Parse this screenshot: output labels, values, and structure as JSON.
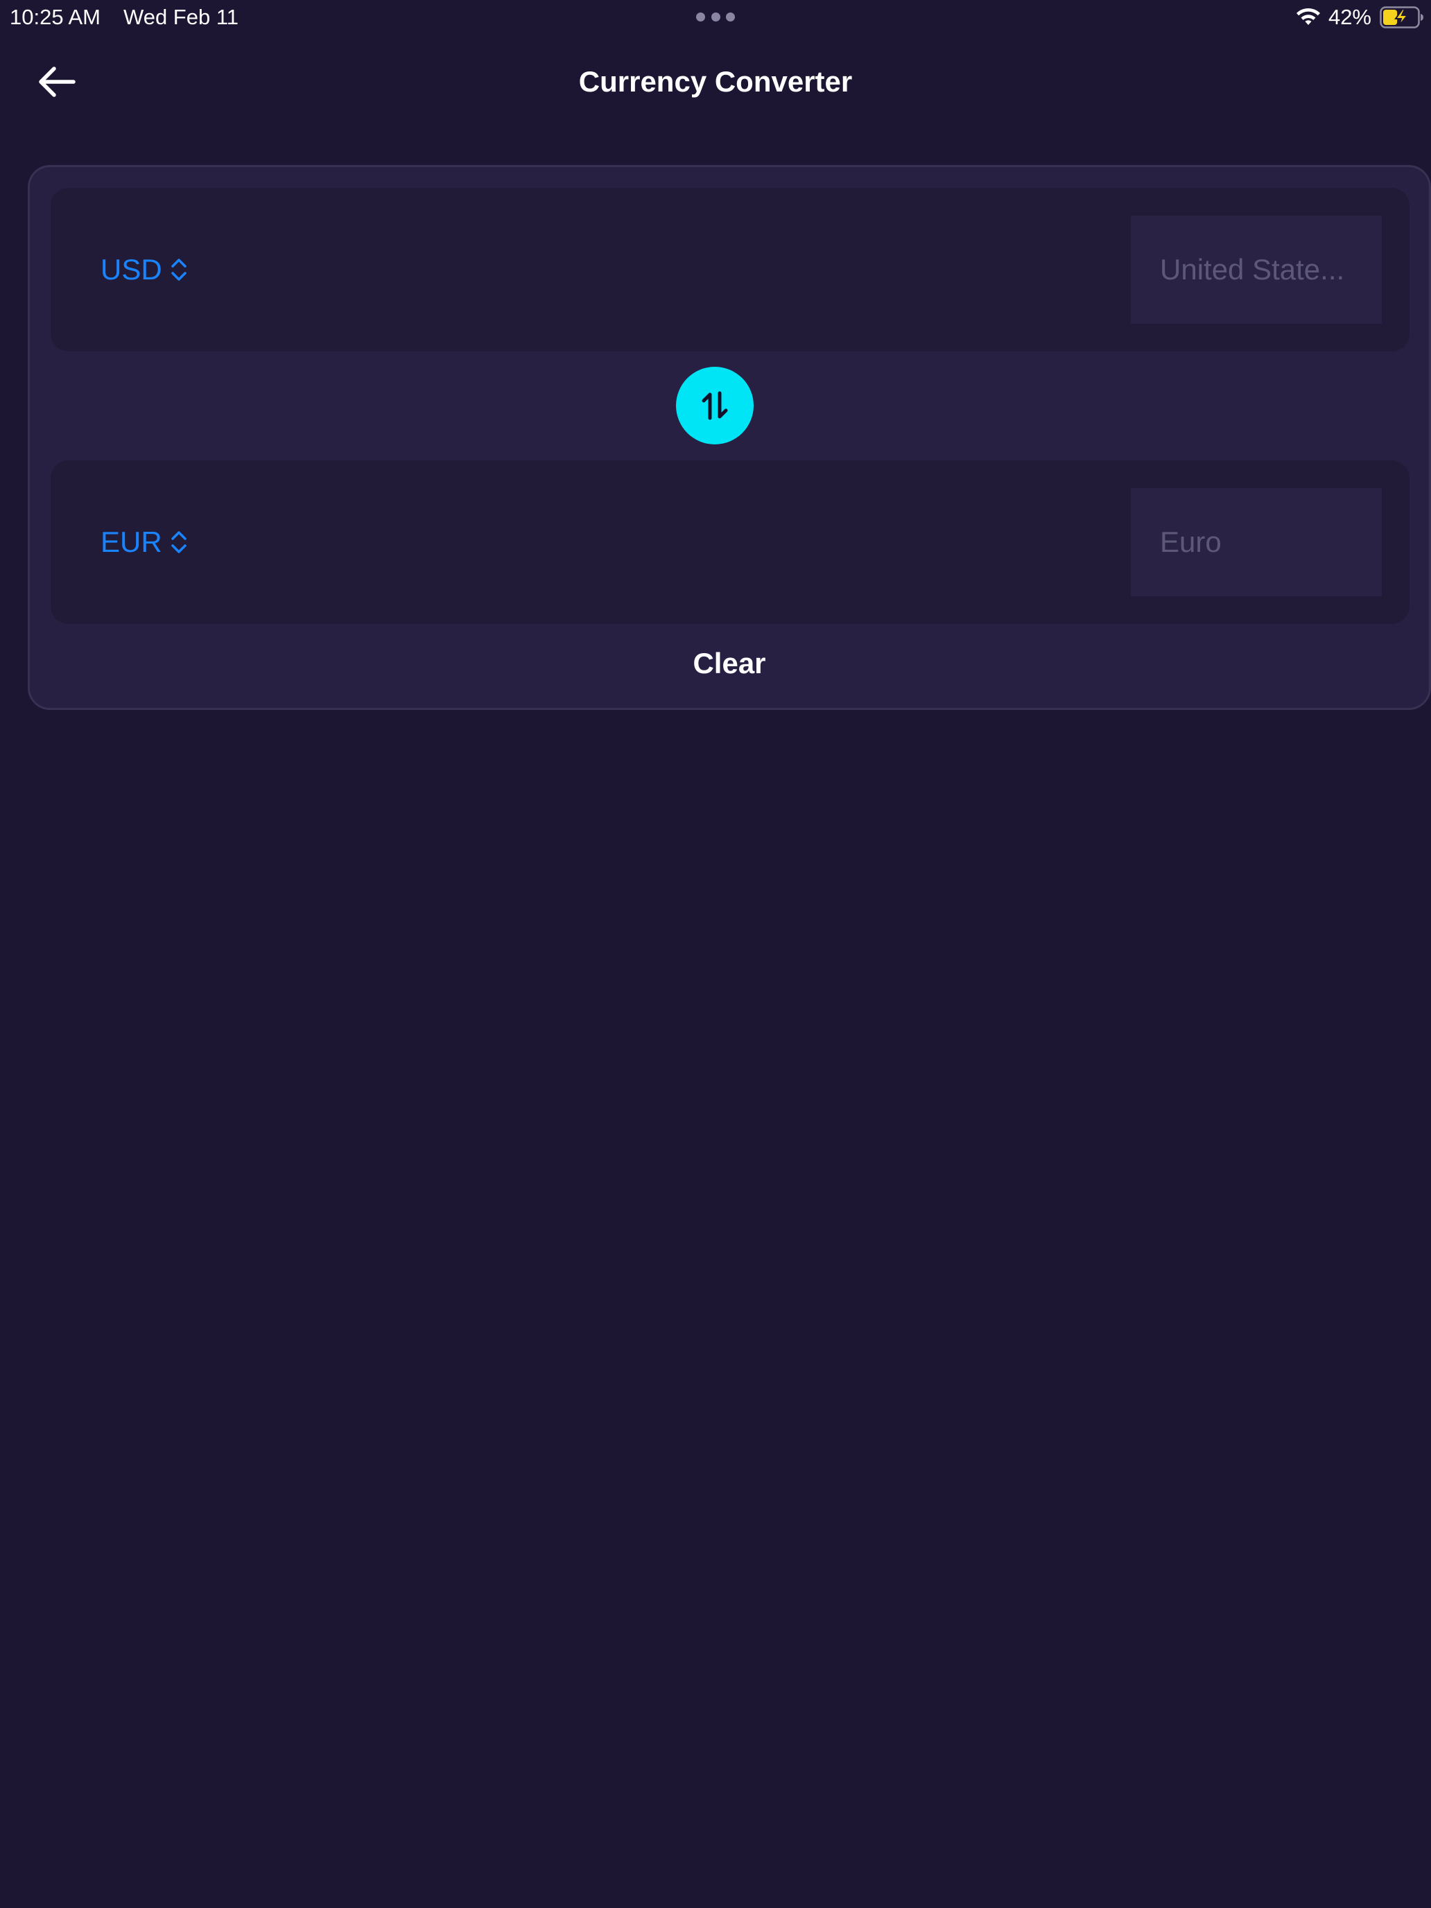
{
  "status_bar": {
    "time": "10:25 AM",
    "date": "Wed Feb 11",
    "battery_percent": "42%",
    "battery_level": 0.42,
    "battery_charging": true,
    "icons": [
      "wifi-icon",
      "battery-icon",
      "multitasking-dots-icon"
    ]
  },
  "nav": {
    "title": "Currency Converter",
    "back_icon": "arrow-left-icon"
  },
  "converter": {
    "from": {
      "code": "USD",
      "placeholder": "United State...",
      "value": ""
    },
    "to": {
      "code": "EUR",
      "placeholder": "Euro",
      "value": ""
    },
    "swap_icon": "swap-vertical-arrows-icon",
    "clear_label": "Clear"
  },
  "colors": {
    "background": "#1c1633",
    "card": "#272043",
    "row": "#211b37",
    "input": "#292245",
    "accent_blue": "#1a84ff",
    "swap_cyan": "#00e5f5",
    "battery_yellow": "#f5d31c"
  }
}
